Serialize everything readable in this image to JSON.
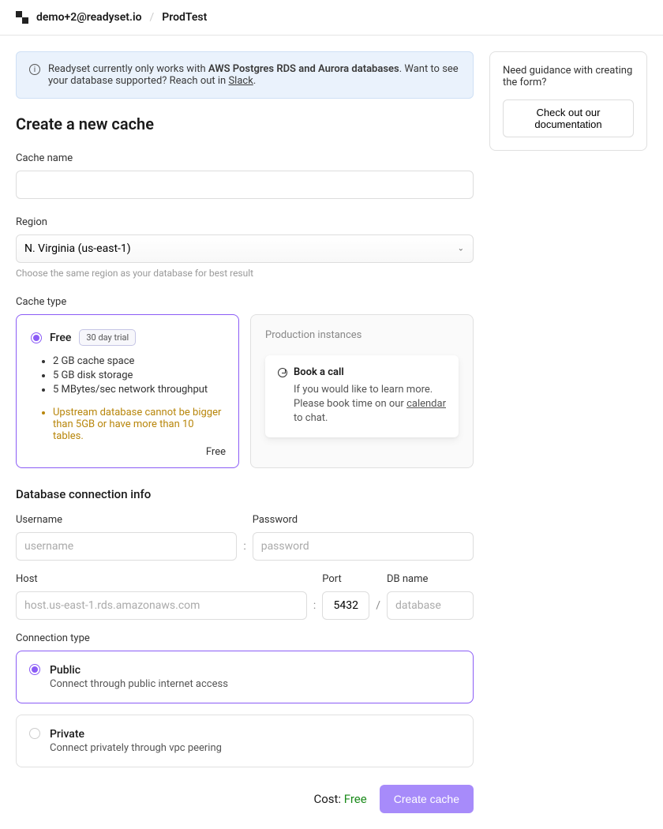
{
  "header": {
    "user": "demo+2@readyset.io",
    "separator": "/",
    "project": "ProdTest"
  },
  "banner": {
    "prefix": "Readyset currently only works with ",
    "bold": "AWS Postgres RDS and Aurora databases",
    "mid": ". Want to see your database supported? Reach out in ",
    "link": "Slack",
    "suffix": "."
  },
  "page_title": "Create a new cache",
  "cache_name": {
    "label": "Cache name",
    "value": ""
  },
  "region": {
    "label": "Region",
    "value": "N. Virginia (us-east-1)",
    "hint": "Choose the same region as your database for best result"
  },
  "cache_type": {
    "label": "Cache type",
    "free": {
      "title": "Free",
      "badge": "30 day trial",
      "items": [
        "2 GB cache space",
        "5 GB disk storage",
        "5 MBytes/sec network throughput"
      ],
      "warning": "Upstream database cannot be bigger than 5GB or have more than 10 tables.",
      "price": "Free"
    },
    "prod": {
      "heading": "Production instances",
      "call_title": "Book a call",
      "call_text_prefix": "If you would like to learn more. Please book time on our ",
      "call_link": "calendar",
      "call_text_suffix": " to chat."
    }
  },
  "db": {
    "heading": "Database connection info",
    "username_label": "Username",
    "username_placeholder": "username",
    "password_label": "Password",
    "password_placeholder": "password",
    "host_label": "Host",
    "host_placeholder": "host.us-east-1.rds.amazonaws.com",
    "port_label": "Port",
    "port_value": "5432",
    "dbname_label": "DB name",
    "dbname_placeholder": "database",
    "sep_colon": ":",
    "sep_slash": "/"
  },
  "conn_type": {
    "label": "Connection type",
    "public": {
      "title": "Public",
      "sub": "Connect through public internet access"
    },
    "private": {
      "title": "Private",
      "sub": "Connect privately through vpc peering"
    }
  },
  "footer": {
    "cost_label": "Cost: ",
    "cost_value": "Free",
    "create_btn": "Create cache"
  },
  "side": {
    "text": "Need guidance with creating the form?",
    "doc_btn": "Check out our documentation"
  }
}
